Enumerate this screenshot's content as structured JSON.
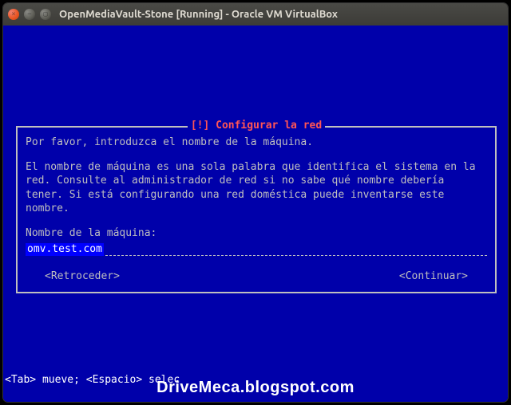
{
  "window": {
    "title": "OpenMediaVault-Stone [Running] - Oracle VM VirtualBox"
  },
  "dialog": {
    "header": "[!] Configurar la red",
    "paragraph1": "Por favor, introduzca el nombre de la máquina.",
    "paragraph2": "El nombre de máquina es una sola palabra que identifica el sistema en la red. Consulte al administrador de red si no sabe qué nombre debería tener. Si está configurando una red doméstica puede inventarse este nombre.",
    "input_label": "Nombre de la máquina:",
    "input_value": "omv.test.com",
    "back_button": "<Retroceder>",
    "continue_button": "<Continuar>"
  },
  "statusbar": {
    "text": "<Tab> mueve; <Espacio> selec"
  },
  "watermark": {
    "text": "DriveMeca.blogspot.com"
  }
}
